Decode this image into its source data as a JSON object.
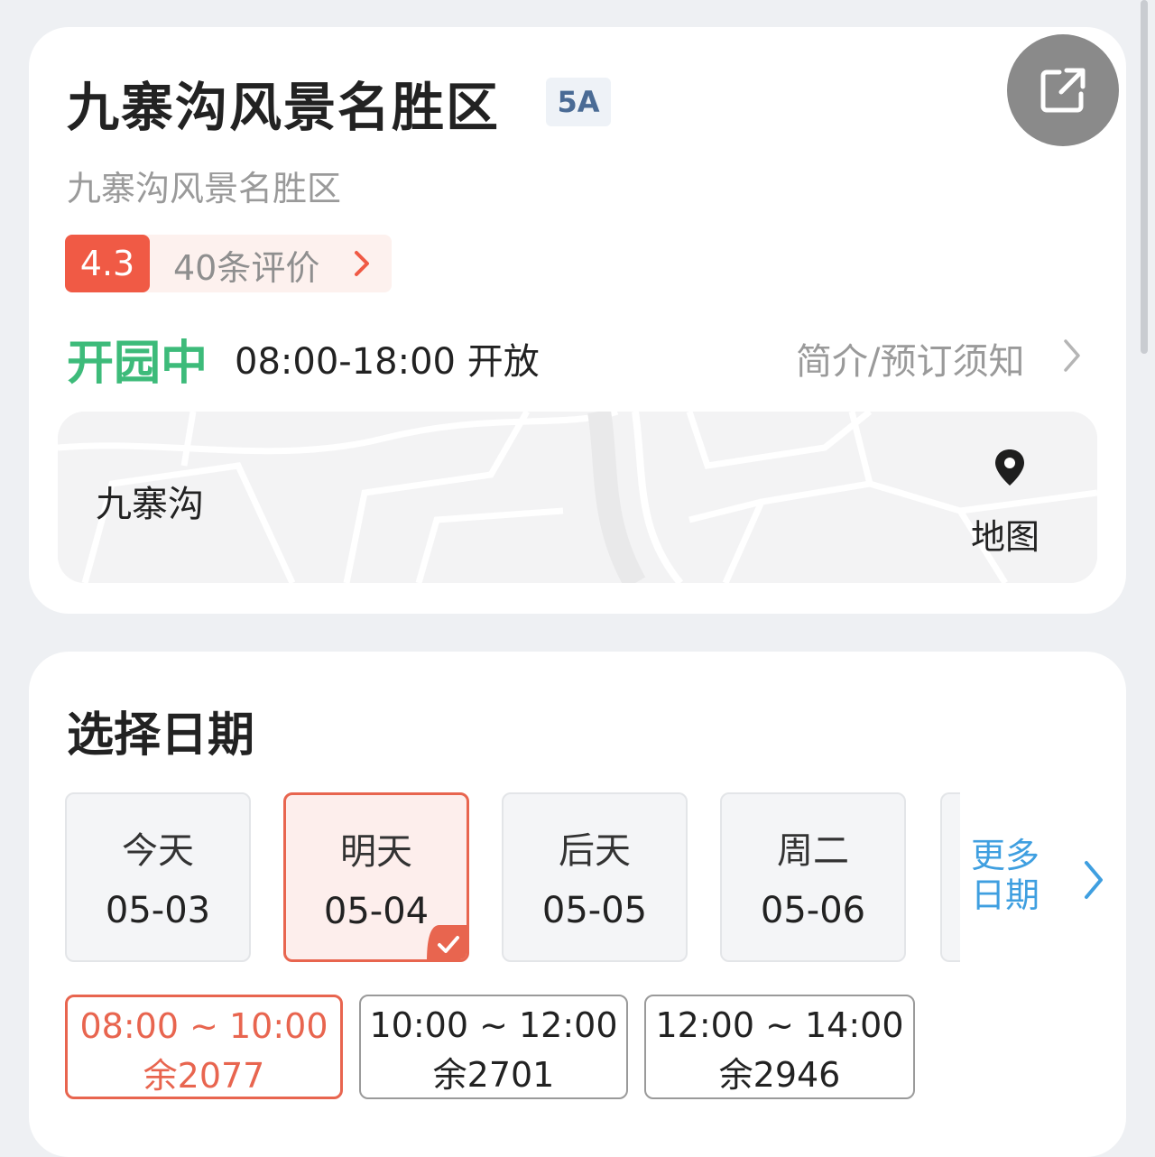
{
  "info": {
    "title": "九寨沟风景名胜区",
    "level_badge": "5A",
    "subtitle": "九寨沟风景名胜区",
    "rating": "4.3",
    "review_count": "40条评价",
    "status": "开园中",
    "hours": "08:00-18:00 开放",
    "intro_link": "简介/预订须知",
    "map_place": "九寨沟",
    "map_label": "地图"
  },
  "date_section": {
    "title": "选择日期",
    "dates": [
      {
        "day": "今天",
        "date": "05-03",
        "selected": false
      },
      {
        "day": "明天",
        "date": "05-04",
        "selected": true
      },
      {
        "day": "后天",
        "date": "05-05",
        "selected": false
      },
      {
        "day": "周二",
        "date": "05-06",
        "selected": false
      }
    ],
    "more_dates": "更多日期",
    "slots": [
      {
        "time": "08:00 ~ 10:00",
        "remain": "余2077",
        "selected": true
      },
      {
        "time": "10:00 ~ 12:00",
        "remain": "余2701",
        "selected": false
      },
      {
        "time": "12:00 ~ 14:00",
        "remain": "余2946",
        "selected": false
      }
    ]
  },
  "colors": {
    "accent_red": "#e8654f",
    "open_green": "#3dbb7a",
    "link_blue": "#3f9fe0",
    "badge_blue": "#4a6b95"
  },
  "icons": [
    "share-icon",
    "chevron-right-icon",
    "map-pin-icon",
    "check-icon"
  ]
}
